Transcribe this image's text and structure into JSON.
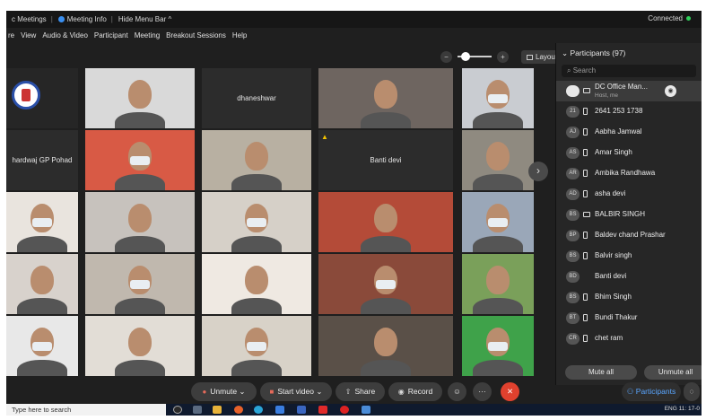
{
  "topbar": {
    "meetings_label": "c Meetings",
    "meeting_info_label": "Meeting Info",
    "hide_menu_label": "Hide Menu Bar ^",
    "connected_label": "Connected"
  },
  "menu": [
    "re",
    "View",
    "Audio & Video",
    "Participant",
    "Meeting",
    "Breakout Sessions",
    "Help"
  ],
  "controls": {
    "zoom_out": "−",
    "zoom_in": "+",
    "layout_label": "Layout"
  },
  "tiles": [
    {
      "name": "",
      "logo": true
    },
    {
      "name": ""
    },
    {
      "name": "dhaneshwar"
    },
    {
      "name": ""
    },
    {
      "name": ""
    },
    {
      "name": "hardwaj GP Pohad"
    },
    {
      "name": ""
    },
    {
      "name": ""
    },
    {
      "name": "Banti devi",
      "warning": true
    },
    {
      "name": ""
    },
    {
      "name": ""
    },
    {
      "name": ""
    },
    {
      "name": ""
    },
    {
      "name": ""
    },
    {
      "name": ""
    },
    {
      "name": ""
    },
    {
      "name": ""
    },
    {
      "name": ""
    },
    {
      "name": ""
    },
    {
      "name": ""
    },
    {
      "name": ""
    },
    {
      "name": ""
    },
    {
      "name": ""
    },
    {
      "name": ""
    },
    {
      "name": ""
    }
  ],
  "participants_panel": {
    "title": "Participants (97)",
    "search_placeholder": "Search",
    "list": [
      {
        "initials": "",
        "name": "DC Office Man...",
        "role": "Host, me",
        "device": "pc",
        "selected": true
      },
      {
        "initials": "21",
        "name": "2641 253 1738",
        "device": "phone"
      },
      {
        "initials": "AJ",
        "name": "Aabha Jamwal",
        "device": "phone"
      },
      {
        "initials": "AS",
        "name": "Amar Singh",
        "device": "phone"
      },
      {
        "initials": "AR",
        "name": "Ambika Randhawa",
        "device": "phone"
      },
      {
        "initials": "AD",
        "name": "asha devi",
        "device": "phone"
      },
      {
        "initials": "BS",
        "name": "BALBIR SINGH",
        "device": "pc"
      },
      {
        "initials": "BP",
        "name": "Baldev chand Prashar",
        "device": "phone"
      },
      {
        "initials": "BS",
        "name": "Balvir singh",
        "device": "phone"
      },
      {
        "initials": "BD",
        "name": "Banti devi",
        "device": "none"
      },
      {
        "initials": "BS",
        "name": "Bhim Singh",
        "device": "phone"
      },
      {
        "initials": "BT",
        "name": "Bundi Thakur",
        "device": "phone"
      },
      {
        "initials": "CR",
        "name": "chet ram",
        "device": "phone"
      }
    ],
    "mute_all": "Mute all",
    "unmute_all": "Unmute all"
  },
  "toolbar": {
    "unmute": "Unmute",
    "start_video": "Start video",
    "share": "Share",
    "record": "Record",
    "reactions": "☺",
    "more": "···",
    "leave": "✕",
    "participants": "Participants",
    "chat": "◌"
  },
  "taskbar": {
    "search_placeholder": "Type here to search",
    "lang": "ENG",
    "time": "11:",
    "date": "17-0"
  }
}
